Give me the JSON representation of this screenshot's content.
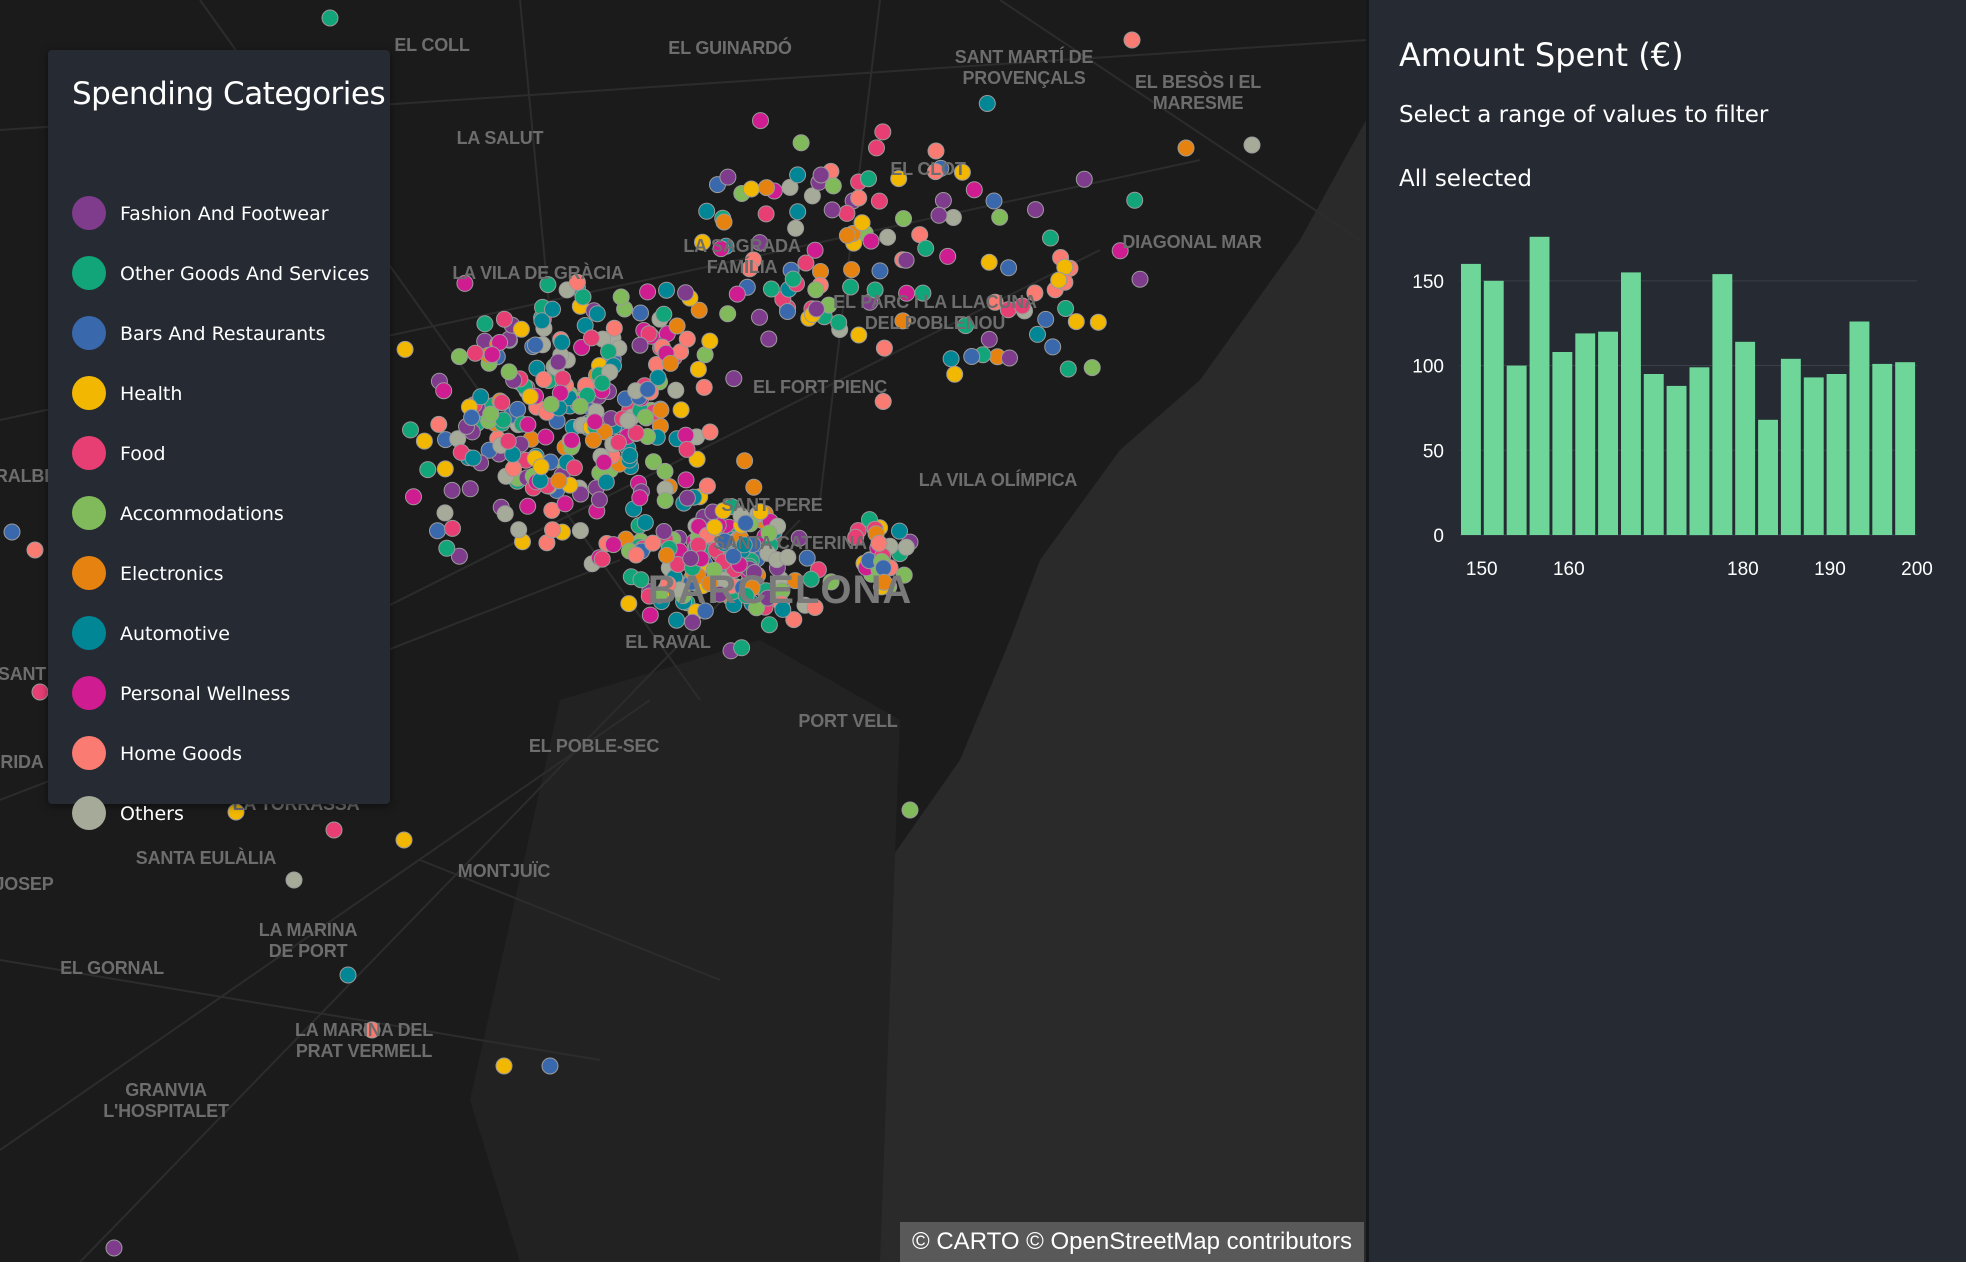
{
  "map": {
    "place_labels": [
      {
        "text": "EL COLL",
        "x": 432,
        "y": 35
      },
      {
        "text": "EL GUINARDÓ",
        "x": 730,
        "y": 38
      },
      {
        "text": "SANT MARTÍ DE\nPROVENÇALS",
        "x": 1024,
        "y": 47
      },
      {
        "text": "EL BESÒS I EL\nMARESME",
        "x": 1198,
        "y": 72
      },
      {
        "text": "LA SALUT",
        "x": 500,
        "y": 128
      },
      {
        "text": "EL CLOT",
        "x": 928,
        "y": 159
      },
      {
        "text": "DIAGONAL MAR",
        "x": 1192,
        "y": 232
      },
      {
        "text": "LA SAGRADA\nFAMÍLIA",
        "x": 742,
        "y": 236
      },
      {
        "text": "LA VILA DE GRÀCIA",
        "x": 538,
        "y": 263
      },
      {
        "text": "EL PARC I LA LLACUNA\nDEL POBLENOU",
        "x": 935,
        "y": 292
      },
      {
        "text": "EL FORT PIENC",
        "x": 820,
        "y": 377
      },
      {
        "text": "LA VILA OLÍMPICA",
        "x": 998,
        "y": 470
      },
      {
        "text": "SANT PERE",
        "x": 772,
        "y": 495
      },
      {
        "text": "SANTA CATERINA",
        "x": 790,
        "y": 533
      },
      {
        "text": "EL RAVAL",
        "x": 668,
        "y": 632
      },
      {
        "text": "PORT VELL",
        "x": 848,
        "y": 711
      },
      {
        "text": "EL POBLE-SEC",
        "x": 594,
        "y": 736
      },
      {
        "text": "SANTA EULÀLIA",
        "x": 206,
        "y": 848
      },
      {
        "text": "MONTJUÏC",
        "x": 504,
        "y": 861
      },
      {
        "text": "LA MARINA\nDE PORT",
        "x": 308,
        "y": 920
      },
      {
        "text": "EL GORNAL",
        "x": 112,
        "y": 958
      },
      {
        "text": "LA MARINA DEL\nPRAT VERMELL",
        "x": 364,
        "y": 1020
      },
      {
        "text": "GRANVIA\nL'HOSPITALET",
        "x": 166,
        "y": 1080
      },
      {
        "text": "RALBI",
        "x": 22,
        "y": 466
      },
      {
        "text": "SANT",
        "x": 22,
        "y": 664
      },
      {
        "text": "RIDA",
        "x": 22,
        "y": 752
      },
      {
        "text": "JOSEP",
        "x": 24,
        "y": 874
      },
      {
        "text": "LA TORRASSA",
        "x": 296,
        "y": 794
      }
    ],
    "city_label": "BARCELONA",
    "attribution": "© CARTO © OpenStreetMap contributors"
  },
  "legend": {
    "title": "Spending Categories",
    "items": [
      {
        "label": "Fashion And Footwear",
        "color": "#7f3c8d"
      },
      {
        "label": "Other Goods And Services",
        "color": "#11a579"
      },
      {
        "label": "Bars And Restaurants",
        "color": "#3969ac"
      },
      {
        "label": "Health",
        "color": "#f2b701"
      },
      {
        "label": "Food",
        "color": "#e73f74"
      },
      {
        "label": "Accommodations",
        "color": "#80ba5a"
      },
      {
        "label": "Electronics",
        "color": "#e68310"
      },
      {
        "label": "Automotive",
        "color": "#008695"
      },
      {
        "label": "Personal Wellness",
        "color": "#cf1c90"
      },
      {
        "label": "Home Goods",
        "color": "#f97b72"
      },
      {
        "label": "Others",
        "color": "#a5aa99"
      }
    ]
  },
  "panel": {
    "title": "Amount Spent (€)",
    "subtitle": "Select a range of values to filter",
    "state": "All selected"
  },
  "chart_data": {
    "type": "bar",
    "title": "Amount Spent (€)",
    "xlabel": "",
    "ylabel": "",
    "x_ticks": [
      150,
      160,
      180,
      190,
      200
    ],
    "y_ticks": [
      0,
      50,
      100,
      150
    ],
    "xlim": [
      147.5,
      200
    ],
    "ylim": [
      0,
      180
    ],
    "bar_color": "#6fd69a",
    "grid": true,
    "values": [
      160,
      150,
      100,
      176,
      108,
      119,
      120,
      155,
      95,
      88,
      99,
      154,
      114,
      68,
      104,
      93,
      95,
      126,
      101,
      102
    ]
  }
}
